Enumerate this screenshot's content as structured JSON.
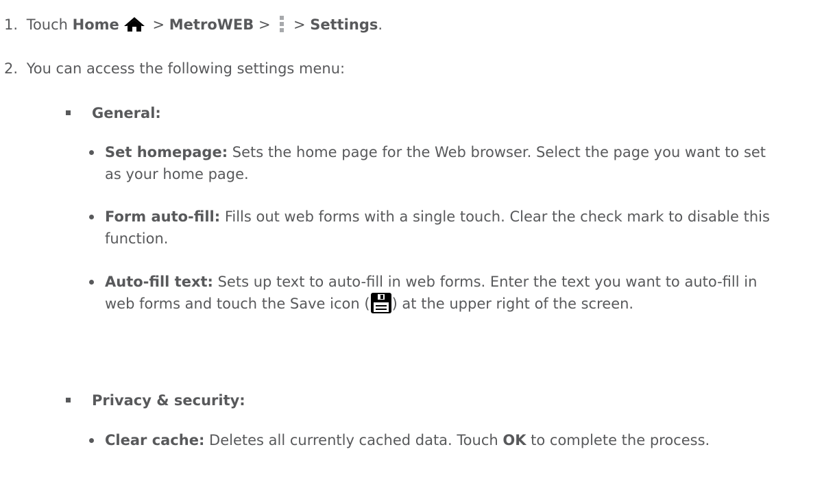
{
  "step1": {
    "number": "1.",
    "touch": "Touch",
    "home": "Home",
    "sep1": ">",
    "app": "MetroWEB",
    "sep2": ">",
    "sep3": ">",
    "settings": "Settings",
    "period": "."
  },
  "step2": {
    "number": "2.",
    "text": "You can access the following settings menu:"
  },
  "general": {
    "label": "General:",
    "items": [
      {
        "title": "Set homepage:",
        "text": " Sets the home page for the Web browser. Select the page you want to set as your home page."
      },
      {
        "title": "Form auto-fill:",
        "text": " Fills out web forms with a single touch. Clear the check mark to disable this function."
      },
      {
        "title": "Auto-fill text:",
        "text_before": " Sets up text to auto-fill in web forms. Enter the text you want to auto-fill in web forms and touch the Save icon (",
        "text_after": ") at the upper right of the screen."
      }
    ]
  },
  "privacy": {
    "label": "Privacy & security:",
    "items": [
      {
        "title": "Clear cache:",
        "text_before": " Deletes all currently cached data. Touch ",
        "ok": "OK",
        "text_after": " to complete the process."
      }
    ]
  },
  "icons": {
    "home": "home-icon",
    "menu": "menu-icon",
    "save": "save-icon"
  },
  "colors": {
    "text": "#58595b"
  }
}
